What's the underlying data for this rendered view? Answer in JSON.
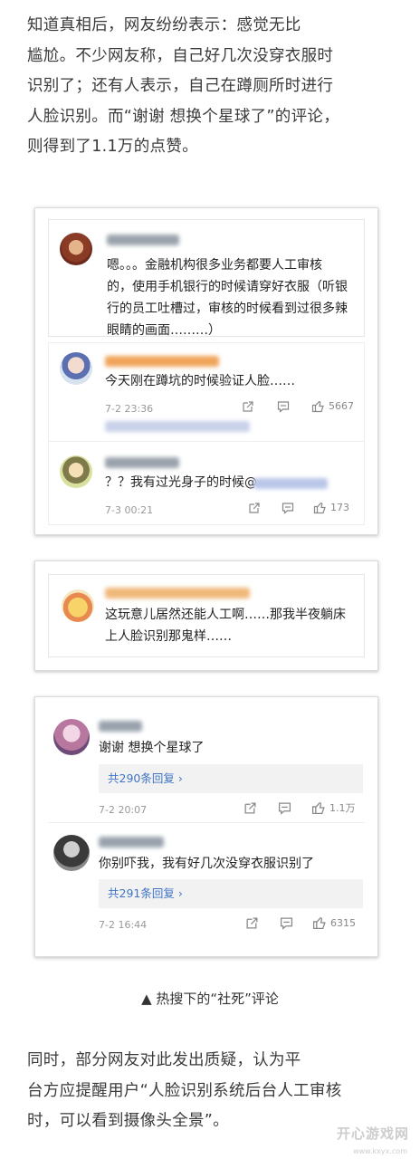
{
  "article": {
    "paragraph1": "知道真相后，网友纷纷表示：感觉无比\n尴尬。不少网友称，自己好几次没穿衣服时\n识别了；还有人表示，自己在蹲厕所时进行\n人脸识别。而“谢谢 想换个星球了”的评论，\n则得到了1.1万的点赞。",
    "caption": "▲ 热搜下的“社死”评论",
    "paragraph2": "同时，部分网友对此发出质疑，认为平\n台方应提醒用户“人脸识别系统后台人工审核\n时，可以看到摄像头全景”。"
  },
  "card1": {
    "top_comment": {
      "text": "嗯。。。金融机构很多业务都要人工审核\n的，使用手机银行的时候请穿好衣服（听银\n行的员工吐槽过，审核的时候看到过很多辣\n眼睛的画面………）"
    },
    "reply1": {
      "text": "今天刚在蹲坑的时候验证人脸……",
      "time": "7-2 23:36",
      "likes": "5667"
    },
    "reply2": {
      "text": "？？我有过光身子的时候@",
      "time": "7-3 00:21",
      "likes": "173"
    }
  },
  "card2": {
    "comment": {
      "text": "这玩意儿居然还能人工啊……那我半夜躺床\n上人脸识别那鬼样……"
    }
  },
  "card3": {
    "comment1": {
      "text": "谢谢 想换个星球了",
      "reply_link": "共290条回复 ›",
      "time": "7-2 20:07",
      "likes": "1.1万"
    },
    "comment2": {
      "text": "你别吓我，我有好几次没穿衣服识别了",
      "reply_link": "共291条回复 ›",
      "time": "7-2 16:44",
      "likes": "6315"
    }
  },
  "watermark": {
    "text": "开心游戏网",
    "sub": "www.kxyx.com"
  },
  "colors": {
    "link_blue": "#3f74c6",
    "name_orange": "#f0a45a",
    "reply_bg": "#f2f2f2"
  }
}
